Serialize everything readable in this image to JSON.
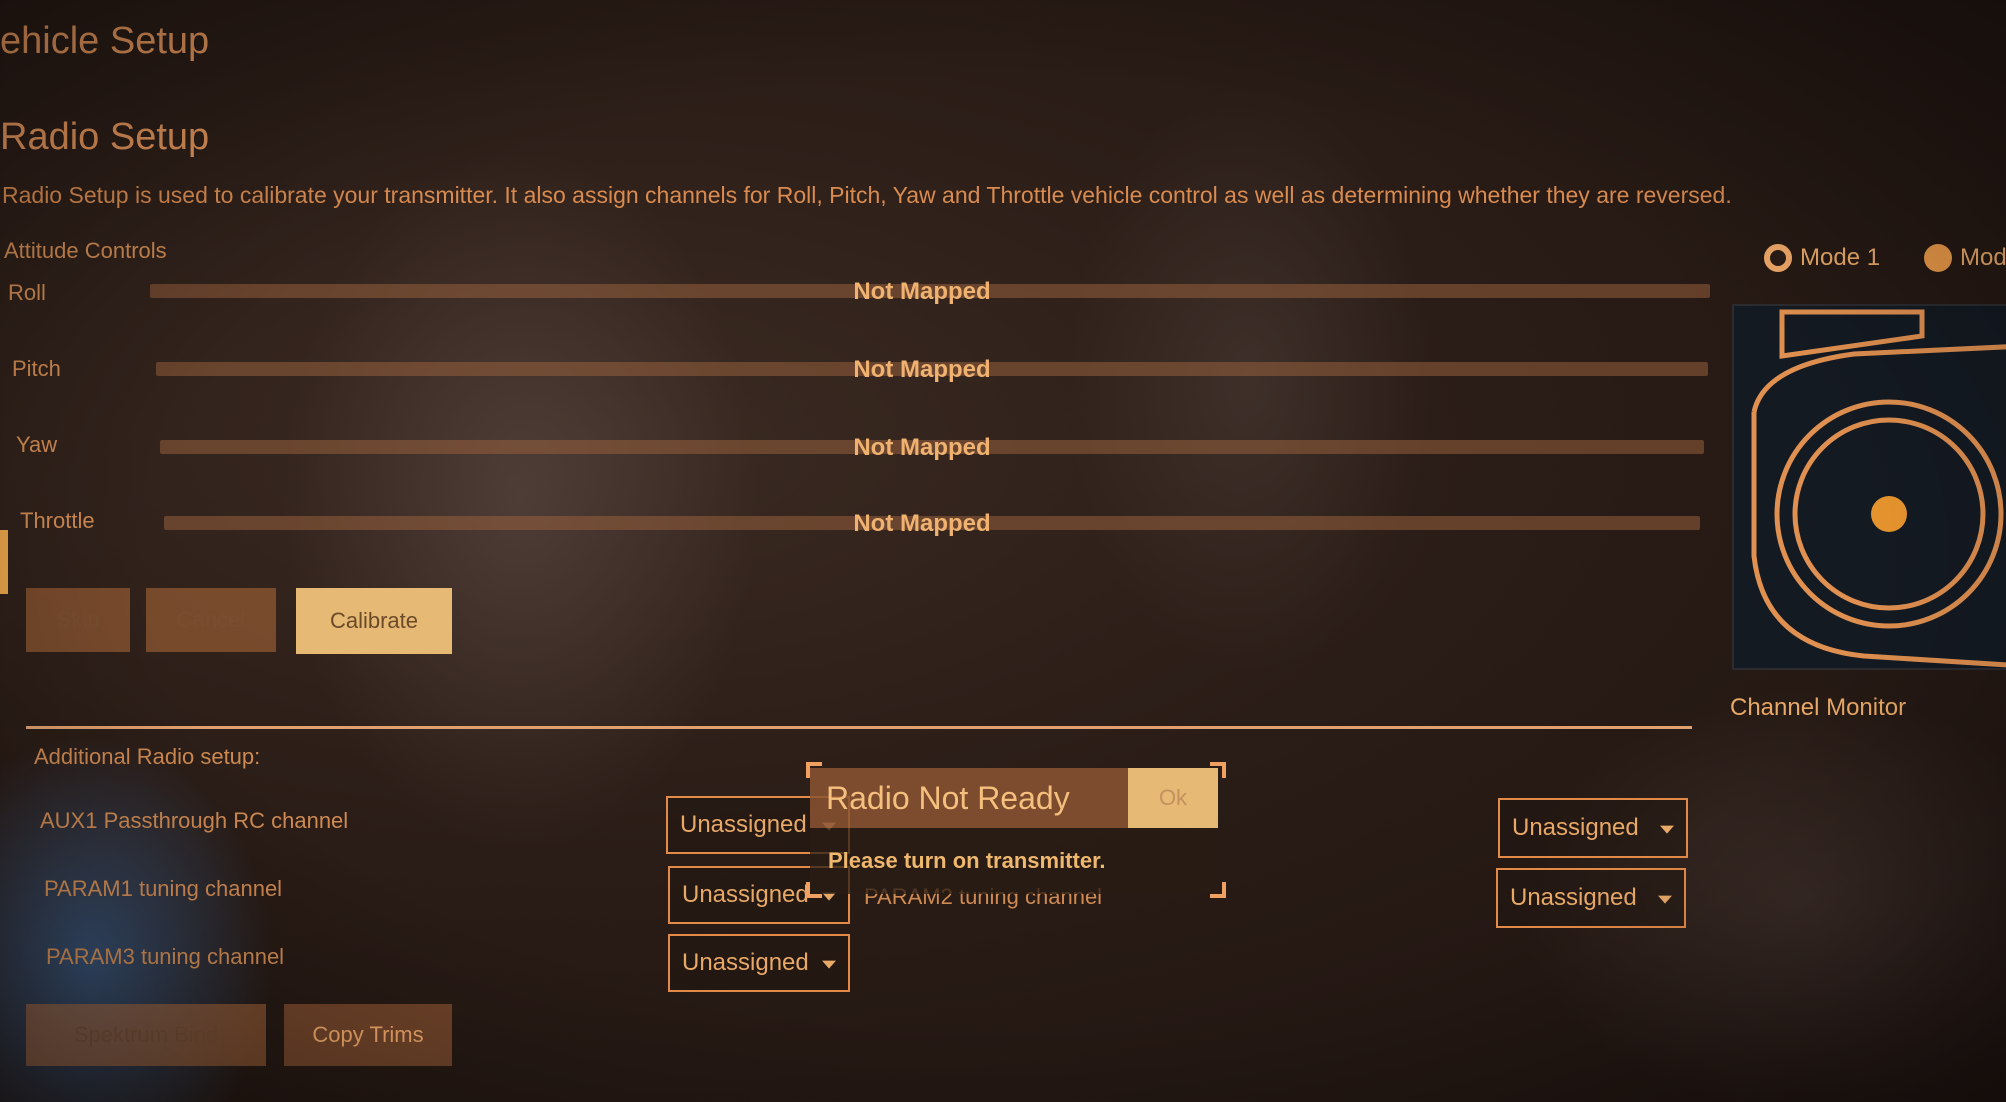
{
  "page": {
    "title": "ehicle Setup",
    "section_title": "Radio Setup",
    "description": "Radio Setup is used to calibrate your transmitter. It also assign channels for Roll, Pitch, Yaw and Throttle vehicle control as well as determining whether they are reversed."
  },
  "attitude": {
    "heading": "Attitude Controls",
    "rows": [
      {
        "label": "Roll",
        "status": "Not Mapped"
      },
      {
        "label": "Pitch",
        "status": "Not Mapped"
      },
      {
        "label": "Yaw",
        "status": "Not Mapped"
      },
      {
        "label": "Throttle",
        "status": "Not Mapped"
      }
    ]
  },
  "calibration_buttons": {
    "skip": "Skip",
    "cancel": "Cancel",
    "calibrate": "Calibrate"
  },
  "modes": {
    "mode1": "Mode 1",
    "mode2": "Mod",
    "selected": "Mode 2"
  },
  "monitor": {
    "label": "Channel Monitor"
  },
  "additional": {
    "heading": "Additional Radio setup:",
    "aux1_label": "AUX1 Passthrough RC channel",
    "param1_label": "PARAM1 tuning channel",
    "param2_label": "PARAM2 tuning channel",
    "param3_label": "PARAM3 tuning channel",
    "combo_value": "Unassigned"
  },
  "bottom_buttons": {
    "spektrum_bind": "Spektrum Bind",
    "copy_trims": "Copy Trims"
  },
  "dialog": {
    "title": "Radio Not Ready",
    "ok": "Ok",
    "message": "Please turn on transmitter."
  },
  "colors": {
    "accent": "#e0935a",
    "button_primary": "#e6ba74",
    "stick_dot": "#e8952e",
    "background": "#2a1c16"
  }
}
